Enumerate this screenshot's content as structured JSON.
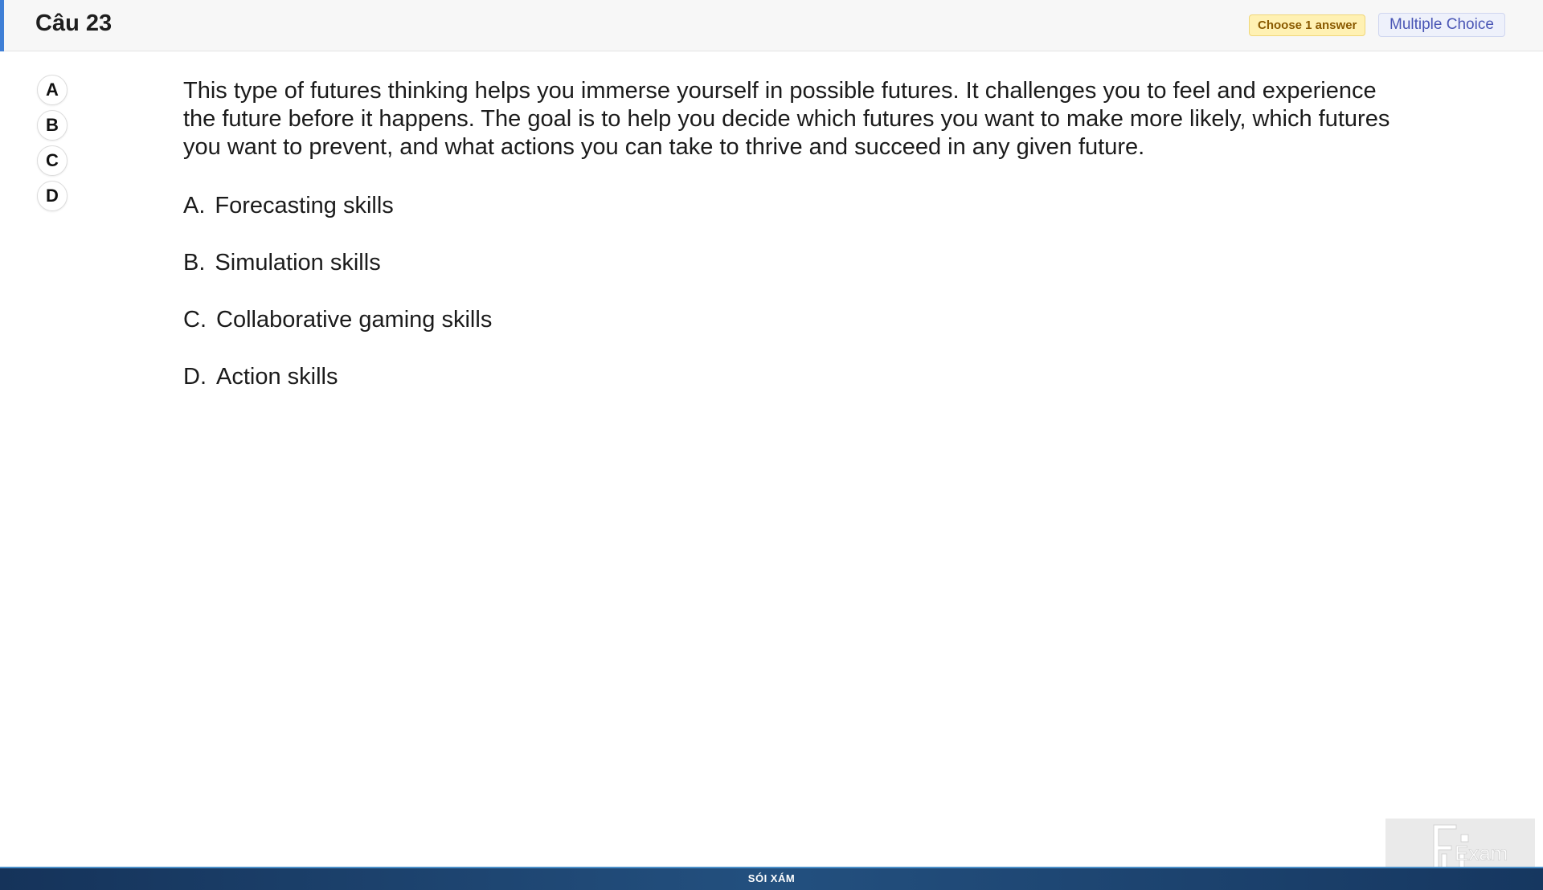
{
  "header": {
    "question_number": "Câu 23",
    "choose_badge": "Choose 1 answer",
    "type_badge": "Multiple Choice",
    "accent_color": "#3f7fd6"
  },
  "answer_buttons": [
    "A",
    "B",
    "C",
    "D"
  ],
  "question": {
    "text": "This type of futures thinking helps you immerse yourself in possible futures. It challenges you to feel and experience the future before it happens. The goal is to help you decide which futures you want to make more likely, which futures you want to prevent, and what actions you can take to thrive and succeed in any given future.",
    "options": [
      {
        "letter": "A.",
        "text": "Forecasting skills"
      },
      {
        "letter": "B.",
        "text": "Simulation skills"
      },
      {
        "letter": "C.",
        "text": "Collaborative gaming skills"
      },
      {
        "letter": "D.",
        "text": "Action skills"
      }
    ]
  },
  "footer": {
    "label": "SÓI XÁM"
  },
  "logo": {
    "icon": "fu-exam-logo-icon"
  }
}
